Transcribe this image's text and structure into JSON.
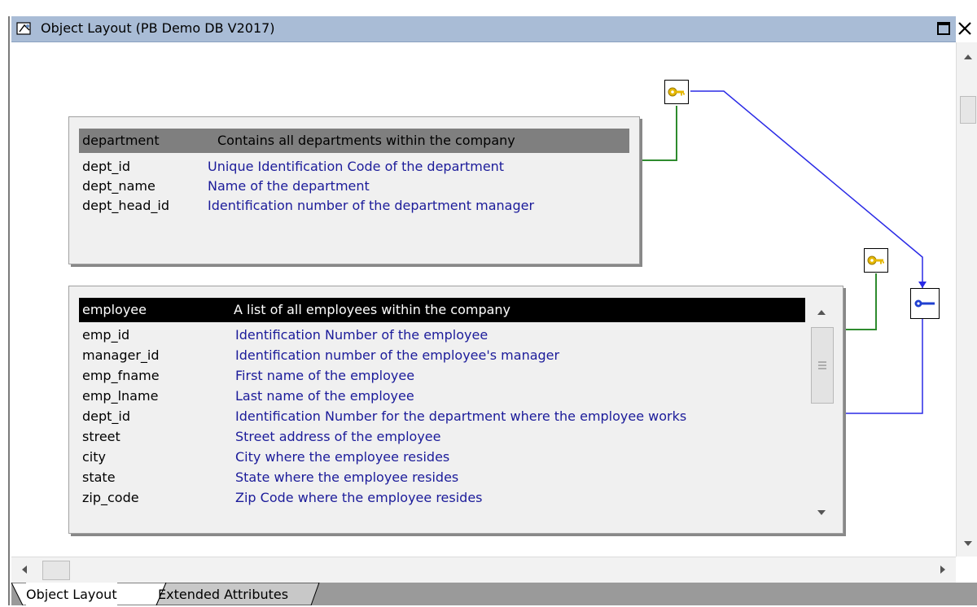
{
  "window": {
    "title": "Object Layout (PB Demo DB V2017)",
    "maximize_glyph": "□",
    "close_glyph": "✕"
  },
  "tables": {
    "department": {
      "name": "department",
      "comment": "Contains all departments within the company",
      "columns": [
        {
          "name": "dept_id",
          "desc": "Unique Identification Code of the department"
        },
        {
          "name": "dept_name",
          "desc": "Name of the department"
        },
        {
          "name": "dept_head_id",
          "desc": "Identification number of the department manager"
        }
      ]
    },
    "employee": {
      "name": "employee",
      "comment": "A list of all employees within the company",
      "columns": [
        {
          "name": "emp_id",
          "desc": "Identification Number of the employee"
        },
        {
          "name": "manager_id",
          "desc": "Identification number of the employee's manager"
        },
        {
          "name": "emp_fname",
          "desc": "First name of the employee"
        },
        {
          "name": "emp_lname",
          "desc": "Last name of the employee"
        },
        {
          "name": "dept_id",
          "desc": "Identification Number for the department where the employee works"
        },
        {
          "name": "street",
          "desc": "Street address of the employee"
        },
        {
          "name": "city",
          "desc": "City where the employee resides"
        },
        {
          "name": "state",
          "desc": "State where the employee resides"
        },
        {
          "name": "zip_code",
          "desc": "Zip Code where the employee resides"
        }
      ]
    }
  },
  "tabs": [
    {
      "label": "Object Layout",
      "active": true
    },
    {
      "label": "Extended Attributes",
      "active": false
    }
  ],
  "colors": {
    "titlebar": "#a9bcd6",
    "description_text": "#1b1b9a",
    "primary_key_link": "#2e8b2e",
    "foreign_key_link": "#2a2ae6",
    "key_icon": "#e6b800",
    "department_header_bg": "#7f7f7f",
    "employee_header_bg": "#000000"
  },
  "icons": {
    "department_key": "primary-key-icon",
    "employee_key": "primary-key-icon",
    "fk_key": "foreign-key-icon"
  }
}
